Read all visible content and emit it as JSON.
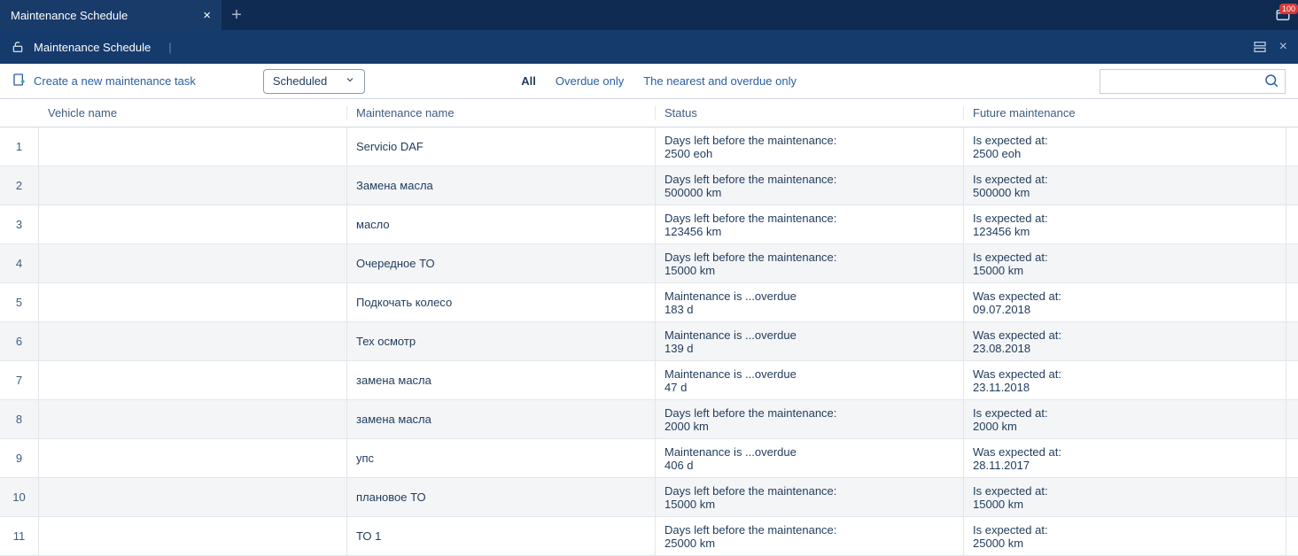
{
  "tab": {
    "title": "Maintenance Schedule"
  },
  "notifications": {
    "count": "100"
  },
  "breadcrumb": {
    "title": "Maintenance Schedule"
  },
  "toolbar": {
    "create_label": "Create a new maintenance task",
    "select_value": "Scheduled",
    "filters": {
      "all": "All",
      "overdue": "Overdue only",
      "nearest": "The nearest and overdue only"
    },
    "search_placeholder": ""
  },
  "columns": {
    "vehicle": "Vehicle name",
    "maintenance": "Maintenance name",
    "status": "Status",
    "future": "Future maintenance"
  },
  "rows": [
    {
      "num": "1",
      "vehicle": "",
      "maintenance": "Servicio DAF",
      "status_l1": "Days left before the maintenance:",
      "status_l2": "2500 eoh",
      "future_l1": "Is expected at:",
      "future_l2": "2500 eoh"
    },
    {
      "num": "2",
      "vehicle": "",
      "maintenance": "Замена масла",
      "status_l1": "Days left before the maintenance:",
      "status_l2": "500000 km",
      "future_l1": "Is expected at:",
      "future_l2": "500000 km"
    },
    {
      "num": "3",
      "vehicle": "",
      "maintenance": "масло",
      "status_l1": "Days left before the maintenance:",
      "status_l2": "123456 km",
      "future_l1": "Is expected at:",
      "future_l2": "123456 km"
    },
    {
      "num": "4",
      "vehicle": "",
      "maintenance": "Очередное ТО",
      "status_l1": "Days left before the maintenance:",
      "status_l2": "15000 km",
      "future_l1": "Is expected at:",
      "future_l2": "15000 km"
    },
    {
      "num": "5",
      "vehicle": "",
      "maintenance": "Подкочать колесо",
      "status_l1": "Maintenance is ...overdue",
      "status_l2": "183 d",
      "future_l1": "Was expected at:",
      "future_l2": "09.07.2018"
    },
    {
      "num": "6",
      "vehicle": "",
      "maintenance": "Тех осмотр",
      "status_l1": "Maintenance is ...overdue",
      "status_l2": "139 d",
      "future_l1": "Was expected at:",
      "future_l2": "23.08.2018"
    },
    {
      "num": "7",
      "vehicle": "",
      "maintenance": "замена масла",
      "status_l1": "Maintenance is ...overdue",
      "status_l2": "47 d",
      "future_l1": "Was expected at:",
      "future_l2": "23.11.2018"
    },
    {
      "num": "8",
      "vehicle": "",
      "maintenance": "замена масла",
      "status_l1": "Days left before the maintenance:",
      "status_l2": "2000 km",
      "future_l1": "Is expected at:",
      "future_l2": "2000 km"
    },
    {
      "num": "9",
      "vehicle": "",
      "maintenance": "упс",
      "status_l1": "Maintenance is ...overdue",
      "status_l2": "406 d",
      "future_l1": "Was expected at:",
      "future_l2": "28.11.2017"
    },
    {
      "num": "10",
      "vehicle": "",
      "maintenance": "плановое ТО",
      "status_l1": "Days left before the maintenance:",
      "status_l2": "15000 km",
      "future_l1": "Is expected at:",
      "future_l2": "15000 km"
    },
    {
      "num": "11",
      "vehicle": "",
      "maintenance": "ТО 1",
      "status_l1": "Days left before the maintenance:",
      "status_l2": "25000 km",
      "future_l1": "Is expected at:",
      "future_l2": "25000 km"
    }
  ]
}
